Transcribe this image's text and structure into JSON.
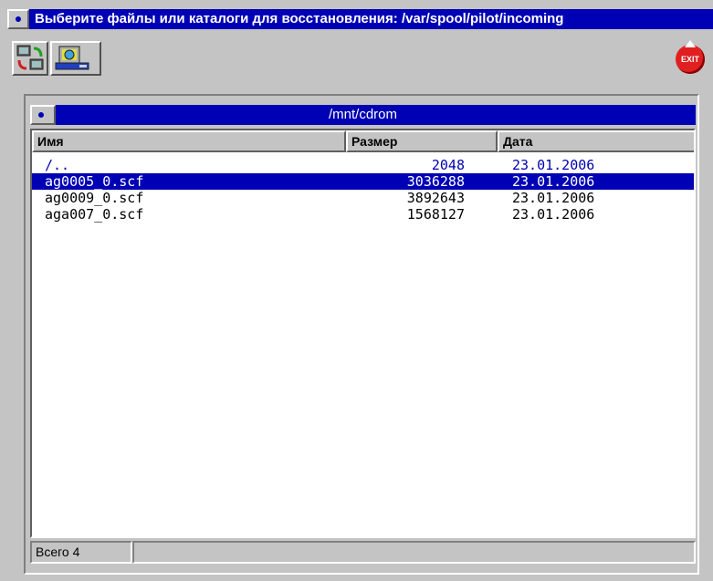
{
  "window": {
    "title": "Выберите файлы или каталоги для восстановления: /var/spool/pilot/incoming"
  },
  "toolbar": {
    "buttons": [
      {
        "icon": "refresh-sync-icon"
      },
      {
        "icon": "cd-drive-icon"
      }
    ],
    "exit_label": "EXIT"
  },
  "panel": {
    "path": "/mnt/cdrom",
    "columns": [
      "Имя",
      "Размер",
      "Дата"
    ],
    "rows": [
      {
        "name": "/..",
        "size": "2048",
        "date": "23.01.2006"
      },
      {
        "name": "ag0005_0.scf",
        "size": "3036288",
        "date": "23.01.2006"
      },
      {
        "name": "ag0009_0.scf",
        "size": "3892643",
        "date": "23.01.2006"
      },
      {
        "name": "aga007_0.scf",
        "size": "1568127",
        "date": "23.01.2006"
      }
    ],
    "selected_row": 1
  },
  "status": {
    "count_text": "Всего 4",
    "extra": ""
  },
  "colors": {
    "title_bg": "#0000b4",
    "window_bg": "#c4c4c4",
    "selection": "#0000b4"
  }
}
